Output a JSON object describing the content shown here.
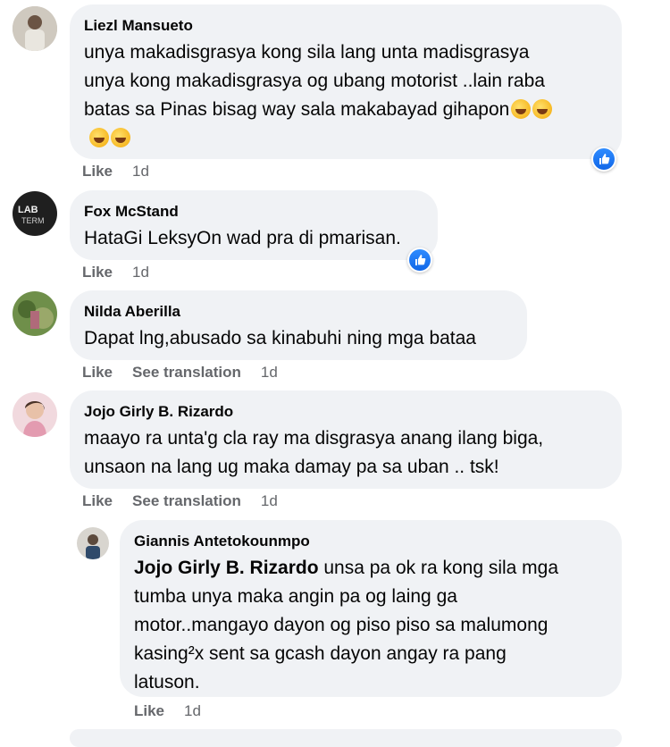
{
  "comments": [
    {
      "author": "Liezl Mansueto",
      "lines": [
        "unya makadisgrasya kong sila lang unta madisgrasya",
        "unya kong makadisgrasya og ubang motorist ..lain raba",
        "batas sa Pinas bisag way sala makabayad gihapon"
      ],
      "emojis": [
        "rolling-on-floor-laughing",
        "rolling-on-floor-laughing",
        "rolling-on-floor-laughing",
        "rolling-on-floor-laughing"
      ],
      "like": "Like",
      "time": "1d",
      "reaction": "like"
    },
    {
      "author": "Fox McStand",
      "lines": [
        "HataGi LeksyOn wad pra di pmarisan."
      ],
      "like": "Like",
      "time": "1d",
      "reaction": "like"
    },
    {
      "author": "Nilda Aberilla",
      "lines": [
        "Dapat lng,abusado sa kinabuhi ning mga bataa"
      ],
      "like": "Like",
      "see_translation": "See translation",
      "time": "1d"
    },
    {
      "author": "Jojo Girly B. Rizardo",
      "lines": [
        "maayo ra unta'g cla ray ma disgrasya anang ilang biga,",
        "unsaon na lang ug maka damay pa sa uban .. tsk!"
      ],
      "like": "Like",
      "see_translation": "See translation",
      "time": "1d"
    }
  ],
  "reply": {
    "author": "Giannis Antetokounmpo",
    "mention": "Jojo Girly B. Rizardo",
    "first_line_rest": " unsa pa ok ra kong sila mga",
    "lines": [
      "tumba unya maka angin pa og laing ga",
      "motor..mangayo dayon og piso piso sa malumong",
      "kasing²x sent sa gcash dayon angay ra pang",
      "latuson."
    ],
    "like": "Like",
    "time": "1d"
  }
}
